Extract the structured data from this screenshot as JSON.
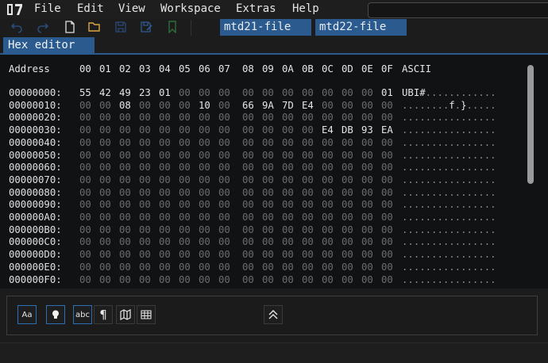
{
  "menu": [
    "File",
    "Edit",
    "View",
    "Workspace",
    "Extras",
    "Help"
  ],
  "file_tabs": [
    "mtd21-file",
    "mtd22-file"
  ],
  "panel_title": "Hex editor",
  "hex": {
    "address_header": "Address",
    "columns": [
      "00",
      "01",
      "02",
      "03",
      "04",
      "05",
      "06",
      "07",
      "08",
      "09",
      "0A",
      "0B",
      "0C",
      "0D",
      "0E",
      "0F"
    ],
    "ascii_header": "ASCII",
    "rows": [
      {
        "addr": "00000000:",
        "bytes": [
          "55",
          "42",
          "49",
          "23",
          "01",
          "00",
          "00",
          "00",
          "00",
          "00",
          "00",
          "00",
          "00",
          "00",
          "00",
          "01"
        ],
        "ascii": "UBI#............"
      },
      {
        "addr": "00000010:",
        "bytes": [
          "00",
          "00",
          "08",
          "00",
          "00",
          "00",
          "10",
          "00",
          "66",
          "9A",
          "7D",
          "E4",
          "00",
          "00",
          "00",
          "00"
        ],
        "ascii": "........f.}....."
      },
      {
        "addr": "00000020:",
        "bytes": [
          "00",
          "00",
          "00",
          "00",
          "00",
          "00",
          "00",
          "00",
          "00",
          "00",
          "00",
          "00",
          "00",
          "00",
          "00",
          "00"
        ],
        "ascii": "................"
      },
      {
        "addr": "00000030:",
        "bytes": [
          "00",
          "00",
          "00",
          "00",
          "00",
          "00",
          "00",
          "00",
          "00",
          "00",
          "00",
          "00",
          "E4",
          "DB",
          "93",
          "EA"
        ],
        "ascii": "................"
      },
      {
        "addr": "00000040:",
        "bytes": [
          "00",
          "00",
          "00",
          "00",
          "00",
          "00",
          "00",
          "00",
          "00",
          "00",
          "00",
          "00",
          "00",
          "00",
          "00",
          "00"
        ],
        "ascii": "................"
      },
      {
        "addr": "00000050:",
        "bytes": [
          "00",
          "00",
          "00",
          "00",
          "00",
          "00",
          "00",
          "00",
          "00",
          "00",
          "00",
          "00",
          "00",
          "00",
          "00",
          "00"
        ],
        "ascii": "................"
      },
      {
        "addr": "00000060:",
        "bytes": [
          "00",
          "00",
          "00",
          "00",
          "00",
          "00",
          "00",
          "00",
          "00",
          "00",
          "00",
          "00",
          "00",
          "00",
          "00",
          "00"
        ],
        "ascii": "................"
      },
      {
        "addr": "00000070:",
        "bytes": [
          "00",
          "00",
          "00",
          "00",
          "00",
          "00",
          "00",
          "00",
          "00",
          "00",
          "00",
          "00",
          "00",
          "00",
          "00",
          "00"
        ],
        "ascii": "................"
      },
      {
        "addr": "00000080:",
        "bytes": [
          "00",
          "00",
          "00",
          "00",
          "00",
          "00",
          "00",
          "00",
          "00",
          "00",
          "00",
          "00",
          "00",
          "00",
          "00",
          "00"
        ],
        "ascii": "................"
      },
      {
        "addr": "00000090:",
        "bytes": [
          "00",
          "00",
          "00",
          "00",
          "00",
          "00",
          "00",
          "00",
          "00",
          "00",
          "00",
          "00",
          "00",
          "00",
          "00",
          "00"
        ],
        "ascii": "................"
      },
      {
        "addr": "000000A0:",
        "bytes": [
          "00",
          "00",
          "00",
          "00",
          "00",
          "00",
          "00",
          "00",
          "00",
          "00",
          "00",
          "00",
          "00",
          "00",
          "00",
          "00"
        ],
        "ascii": "................"
      },
      {
        "addr": "000000B0:",
        "bytes": [
          "00",
          "00",
          "00",
          "00",
          "00",
          "00",
          "00",
          "00",
          "00",
          "00",
          "00",
          "00",
          "00",
          "00",
          "00",
          "00"
        ],
        "ascii": "................"
      },
      {
        "addr": "000000C0:",
        "bytes": [
          "00",
          "00",
          "00",
          "00",
          "00",
          "00",
          "00",
          "00",
          "00",
          "00",
          "00",
          "00",
          "00",
          "00",
          "00",
          "00"
        ],
        "ascii": "................"
      },
      {
        "addr": "000000D0:",
        "bytes": [
          "00",
          "00",
          "00",
          "00",
          "00",
          "00",
          "00",
          "00",
          "00",
          "00",
          "00",
          "00",
          "00",
          "00",
          "00",
          "00"
        ],
        "ascii": "................"
      },
      {
        "addr": "000000E0:",
        "bytes": [
          "00",
          "00",
          "00",
          "00",
          "00",
          "00",
          "00",
          "00",
          "00",
          "00",
          "00",
          "00",
          "00",
          "00",
          "00",
          "00"
        ],
        "ascii": "................"
      },
      {
        "addr": "000000F0:",
        "bytes": [
          "00",
          "00",
          "00",
          "00",
          "00",
          "00",
          "00",
          "00",
          "00",
          "00",
          "00",
          "00",
          "00",
          "00",
          "00",
          "00"
        ],
        "ascii": "................"
      }
    ]
  },
  "bottom_buttons": [
    {
      "name": "font-size-button",
      "label": "Aa"
    },
    {
      "name": "highlight-button",
      "icon": "lightbulb-icon"
    },
    {
      "name": "string-view-button",
      "label": "abc"
    },
    {
      "name": "paragraph-button",
      "label": "¶"
    },
    {
      "name": "map-button",
      "icon": "map-icon"
    },
    {
      "name": "table-button",
      "icon": "table-icon"
    }
  ],
  "colors": {
    "accent": "#2b5a8e",
    "zero_byte": "#6c6c6c",
    "nonzero_byte": "#e6e6e6"
  }
}
